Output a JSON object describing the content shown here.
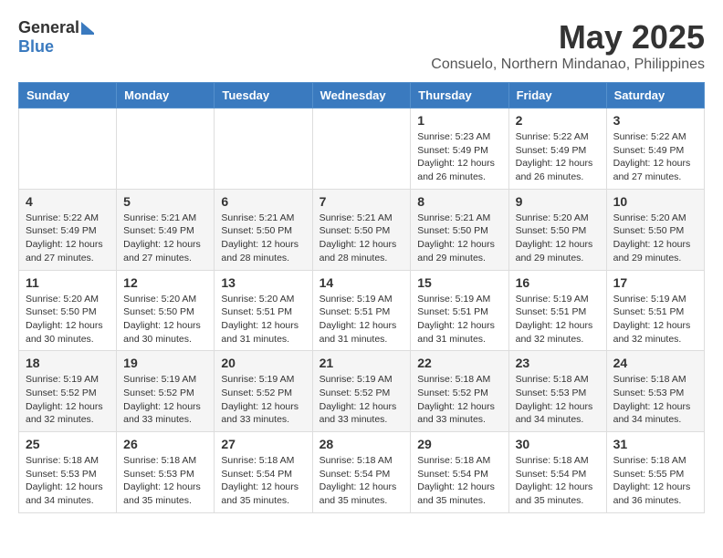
{
  "logo": {
    "general": "General",
    "blue": "Blue"
  },
  "title": {
    "month_year": "May 2025",
    "location": "Consuelo, Northern Mindanao, Philippines"
  },
  "weekdays": [
    "Sunday",
    "Monday",
    "Tuesday",
    "Wednesday",
    "Thursday",
    "Friday",
    "Saturday"
  ],
  "weeks": [
    [
      {
        "day": "",
        "info": ""
      },
      {
        "day": "",
        "info": ""
      },
      {
        "day": "",
        "info": ""
      },
      {
        "day": "",
        "info": ""
      },
      {
        "day": "1",
        "info": "Sunrise: 5:23 AM\nSunset: 5:49 PM\nDaylight: 12 hours and 26 minutes."
      },
      {
        "day": "2",
        "info": "Sunrise: 5:22 AM\nSunset: 5:49 PM\nDaylight: 12 hours and 26 minutes."
      },
      {
        "day": "3",
        "info": "Sunrise: 5:22 AM\nSunset: 5:49 PM\nDaylight: 12 hours and 27 minutes."
      }
    ],
    [
      {
        "day": "4",
        "info": "Sunrise: 5:22 AM\nSunset: 5:49 PM\nDaylight: 12 hours and 27 minutes."
      },
      {
        "day": "5",
        "info": "Sunrise: 5:21 AM\nSunset: 5:49 PM\nDaylight: 12 hours and 27 minutes."
      },
      {
        "day": "6",
        "info": "Sunrise: 5:21 AM\nSunset: 5:50 PM\nDaylight: 12 hours and 28 minutes."
      },
      {
        "day": "7",
        "info": "Sunrise: 5:21 AM\nSunset: 5:50 PM\nDaylight: 12 hours and 28 minutes."
      },
      {
        "day": "8",
        "info": "Sunrise: 5:21 AM\nSunset: 5:50 PM\nDaylight: 12 hours and 29 minutes."
      },
      {
        "day": "9",
        "info": "Sunrise: 5:20 AM\nSunset: 5:50 PM\nDaylight: 12 hours and 29 minutes."
      },
      {
        "day": "10",
        "info": "Sunrise: 5:20 AM\nSunset: 5:50 PM\nDaylight: 12 hours and 29 minutes."
      }
    ],
    [
      {
        "day": "11",
        "info": "Sunrise: 5:20 AM\nSunset: 5:50 PM\nDaylight: 12 hours and 30 minutes."
      },
      {
        "day": "12",
        "info": "Sunrise: 5:20 AM\nSunset: 5:50 PM\nDaylight: 12 hours and 30 minutes."
      },
      {
        "day": "13",
        "info": "Sunrise: 5:20 AM\nSunset: 5:51 PM\nDaylight: 12 hours and 31 minutes."
      },
      {
        "day": "14",
        "info": "Sunrise: 5:19 AM\nSunset: 5:51 PM\nDaylight: 12 hours and 31 minutes."
      },
      {
        "day": "15",
        "info": "Sunrise: 5:19 AM\nSunset: 5:51 PM\nDaylight: 12 hours and 31 minutes."
      },
      {
        "day": "16",
        "info": "Sunrise: 5:19 AM\nSunset: 5:51 PM\nDaylight: 12 hours and 32 minutes."
      },
      {
        "day": "17",
        "info": "Sunrise: 5:19 AM\nSunset: 5:51 PM\nDaylight: 12 hours and 32 minutes."
      }
    ],
    [
      {
        "day": "18",
        "info": "Sunrise: 5:19 AM\nSunset: 5:52 PM\nDaylight: 12 hours and 32 minutes."
      },
      {
        "day": "19",
        "info": "Sunrise: 5:19 AM\nSunset: 5:52 PM\nDaylight: 12 hours and 33 minutes."
      },
      {
        "day": "20",
        "info": "Sunrise: 5:19 AM\nSunset: 5:52 PM\nDaylight: 12 hours and 33 minutes."
      },
      {
        "day": "21",
        "info": "Sunrise: 5:19 AM\nSunset: 5:52 PM\nDaylight: 12 hours and 33 minutes."
      },
      {
        "day": "22",
        "info": "Sunrise: 5:18 AM\nSunset: 5:52 PM\nDaylight: 12 hours and 33 minutes."
      },
      {
        "day": "23",
        "info": "Sunrise: 5:18 AM\nSunset: 5:53 PM\nDaylight: 12 hours and 34 minutes."
      },
      {
        "day": "24",
        "info": "Sunrise: 5:18 AM\nSunset: 5:53 PM\nDaylight: 12 hours and 34 minutes."
      }
    ],
    [
      {
        "day": "25",
        "info": "Sunrise: 5:18 AM\nSunset: 5:53 PM\nDaylight: 12 hours and 34 minutes."
      },
      {
        "day": "26",
        "info": "Sunrise: 5:18 AM\nSunset: 5:53 PM\nDaylight: 12 hours and 35 minutes."
      },
      {
        "day": "27",
        "info": "Sunrise: 5:18 AM\nSunset: 5:54 PM\nDaylight: 12 hours and 35 minutes."
      },
      {
        "day": "28",
        "info": "Sunrise: 5:18 AM\nSunset: 5:54 PM\nDaylight: 12 hours and 35 minutes."
      },
      {
        "day": "29",
        "info": "Sunrise: 5:18 AM\nSunset: 5:54 PM\nDaylight: 12 hours and 35 minutes."
      },
      {
        "day": "30",
        "info": "Sunrise: 5:18 AM\nSunset: 5:54 PM\nDaylight: 12 hours and 35 minutes."
      },
      {
        "day": "31",
        "info": "Sunrise: 5:18 AM\nSunset: 5:55 PM\nDaylight: 12 hours and 36 minutes."
      }
    ]
  ]
}
